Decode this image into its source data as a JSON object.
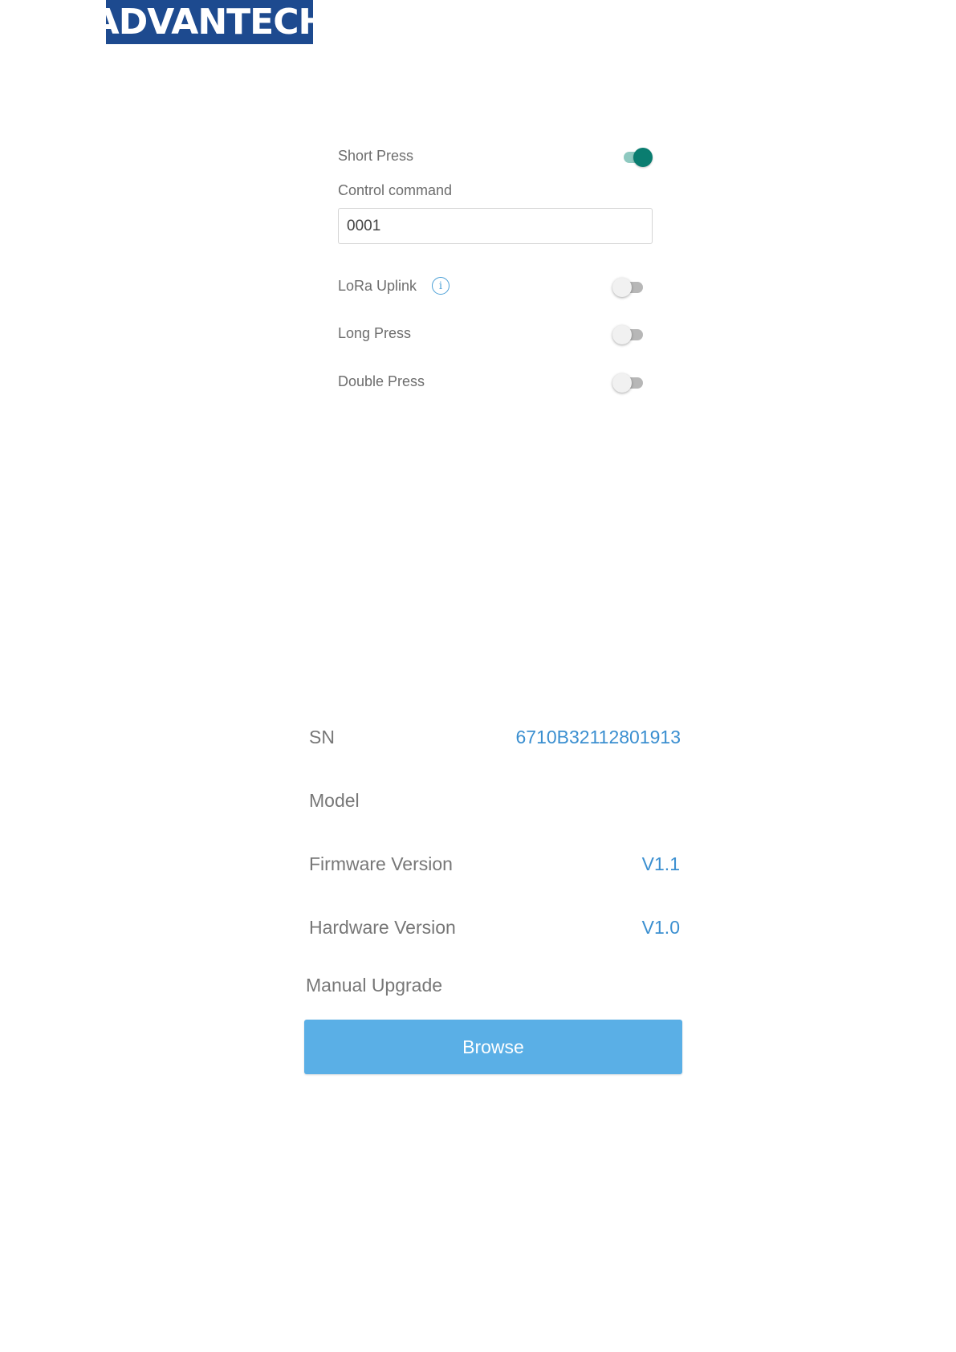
{
  "logo": {
    "text": "ADVANTECH",
    "color": "#1d4a8f"
  },
  "settings": {
    "short_press_label": "Short Press",
    "short_press_on": true,
    "control_command_label": "Control command",
    "control_command_value": "0001",
    "lora_uplink_label": "LoRa Uplink",
    "lora_uplink_on": false,
    "long_press_label": "Long Press",
    "long_press_on": false,
    "double_press_label": "Double Press",
    "double_press_on": false,
    "info_icon_glyph": "i"
  },
  "device_info": {
    "sn_label": "SN",
    "sn_value": "6710B32112801913",
    "model_label": "Model",
    "model_value": "",
    "firmware_label": "Firmware Version",
    "firmware_value": "V1.1",
    "hardware_label": "Hardware Version",
    "hardware_value": "V1.0",
    "manual_upgrade_label": "Manual Upgrade",
    "browse_label": "Browse"
  },
  "colors": {
    "accent_teal": "#0a7d70",
    "value_blue": "#3b8fd0",
    "button_blue": "#5aafe6"
  }
}
